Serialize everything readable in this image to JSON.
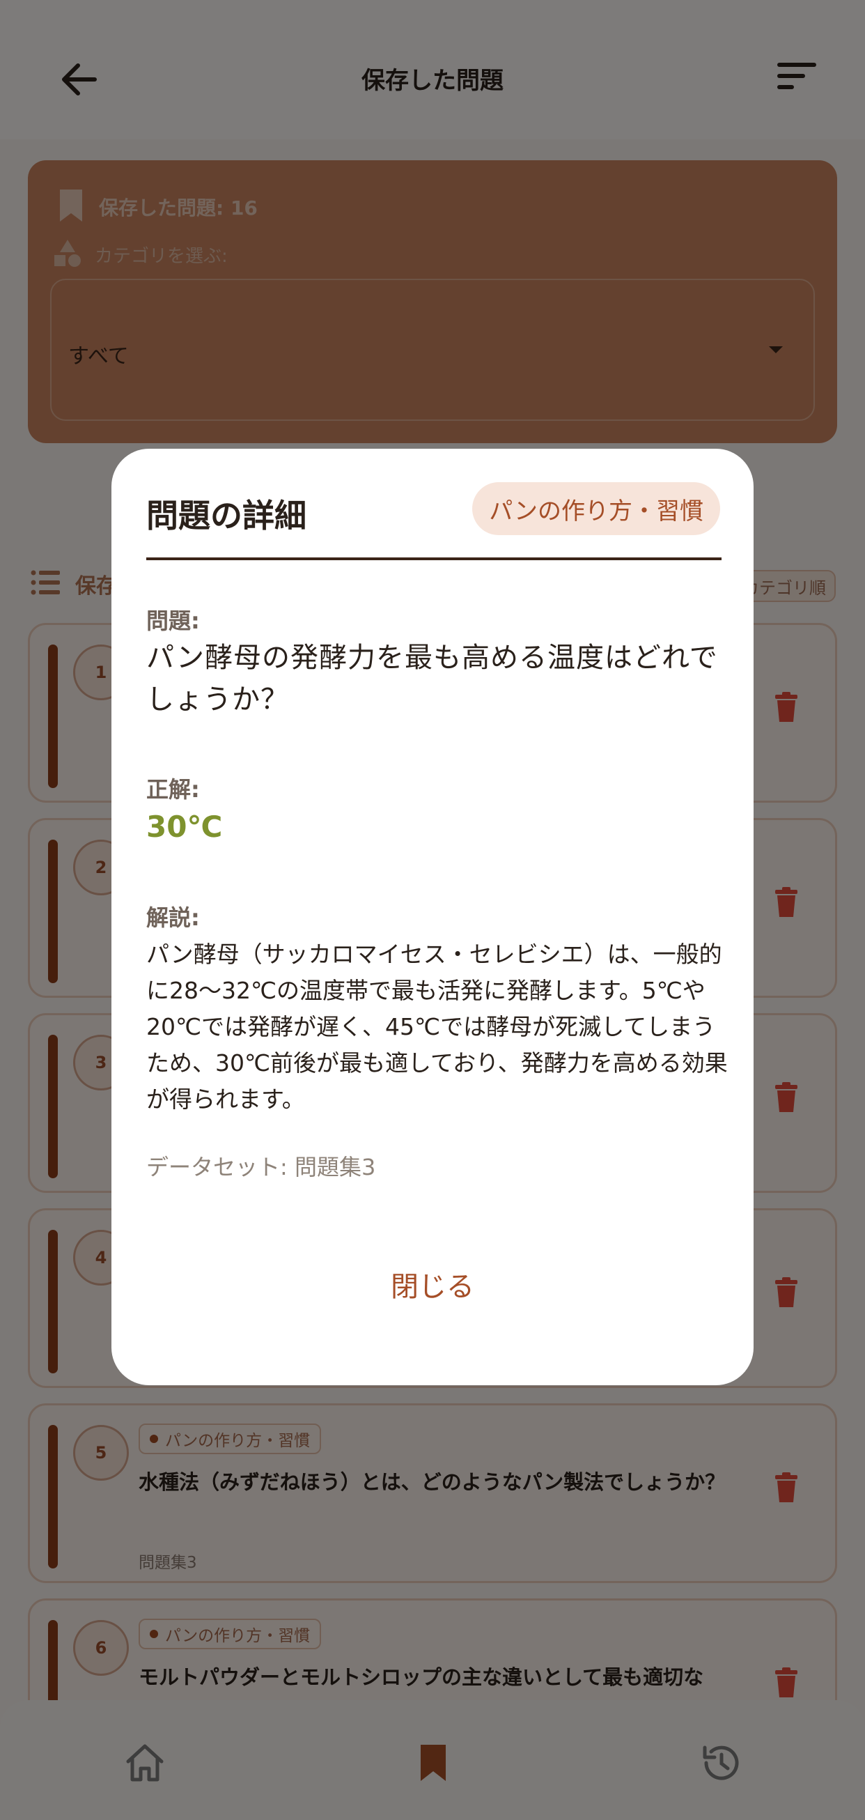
{
  "header": {
    "title": "保存した問題"
  },
  "summary": {
    "saved_count_label": "保存した問題: 16",
    "category_prompt": "カテゴリを選ぶ:",
    "category_value": "すべて"
  },
  "list": {
    "title": "保存",
    "sort_chip": "カテゴリ順"
  },
  "questions": [
    {
      "number": "1",
      "category": "",
      "text": "",
      "dataset": ""
    },
    {
      "number": "2",
      "category": "",
      "text": "",
      "dataset": ""
    },
    {
      "number": "3",
      "category": "",
      "text": "",
      "dataset": ""
    },
    {
      "number": "4",
      "category": "",
      "text": "",
      "dataset": ""
    },
    {
      "number": "5",
      "category": "パンの作り方・習慣",
      "text": "水種法（みずだねほう）とは、どのようなパン製法でしょうか？",
      "dataset": "問題集3"
    },
    {
      "number": "6",
      "category": "パンの作り方・習慣",
      "text": "モルトパウダーとモルトシロップの主な違いとして最も適切な",
      "dataset": ""
    }
  ],
  "modal": {
    "title": "問題の詳細",
    "category": "パンの作り方・習慣",
    "question_label": "問題:",
    "question": "パン酵母の発酵力を最も高める温度はどれでしょうか？",
    "answer_label": "正解:",
    "answer": "30℃",
    "explanation_label": "解説:",
    "explanation": "パン酵母（サッカロマイセス・セレビシエ）は、一般的に28〜32℃の温度帯で最も活発に発酵します。5℃や20℃では発酵が遅く、45℃では酵母が死滅してしまうため、30℃前後が最も適しており、発酵力を高める効果が得られます。",
    "dataset": "データセット: 問題集3",
    "close_label": "閉じる"
  },
  "nav": {
    "active": "bookmarks"
  },
  "colors": {
    "brand": "#a54e27",
    "accent_bar": "#8c3d18",
    "answer": "#7e922e",
    "trash": "#e04a3a"
  }
}
